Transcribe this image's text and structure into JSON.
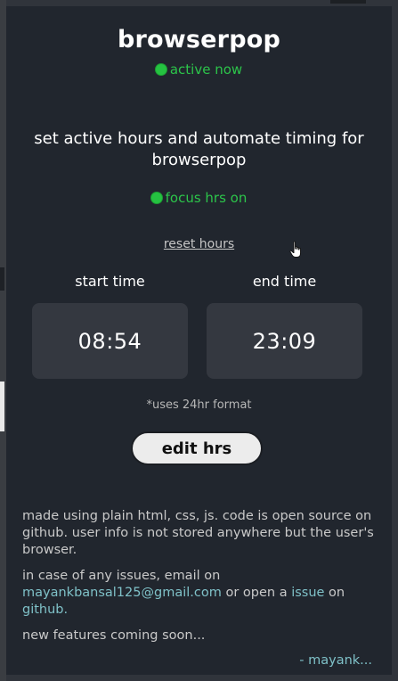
{
  "app": {
    "title": "browserpop",
    "status_active": "active now"
  },
  "description": "set active hours and automate timing for browserpop",
  "focus_status": "focus hrs on",
  "reset_link": "reset hours",
  "times": {
    "start_label": "start time",
    "start_value": "08:54",
    "end_label": "end time",
    "end_value": "23:09",
    "format_note": "*uses 24hr format"
  },
  "edit_button": "edit hrs",
  "footer": {
    "p1": "made using plain html, css, js. code is open source on github. user info is not stored anywhere but the user's browser.",
    "p2_prefix": "in case of any issues, email on ",
    "email": "mayankbansal125@gmail.com",
    "p2_middle": " or open a ",
    "issue_link": "issue",
    "p2_on": " on ",
    "github_link": "github.",
    "p3": "new features coming soon...",
    "signature": "- mayank..."
  },
  "colors": {
    "background": "#21262e",
    "time_box": "#343840",
    "status_green": "#25c241",
    "link": "#7fc1c8",
    "button_bg": "#ececec"
  },
  "icons": {
    "status_dot": "green-dot-icon",
    "cursor": "hand-pointer-cursor-icon"
  }
}
